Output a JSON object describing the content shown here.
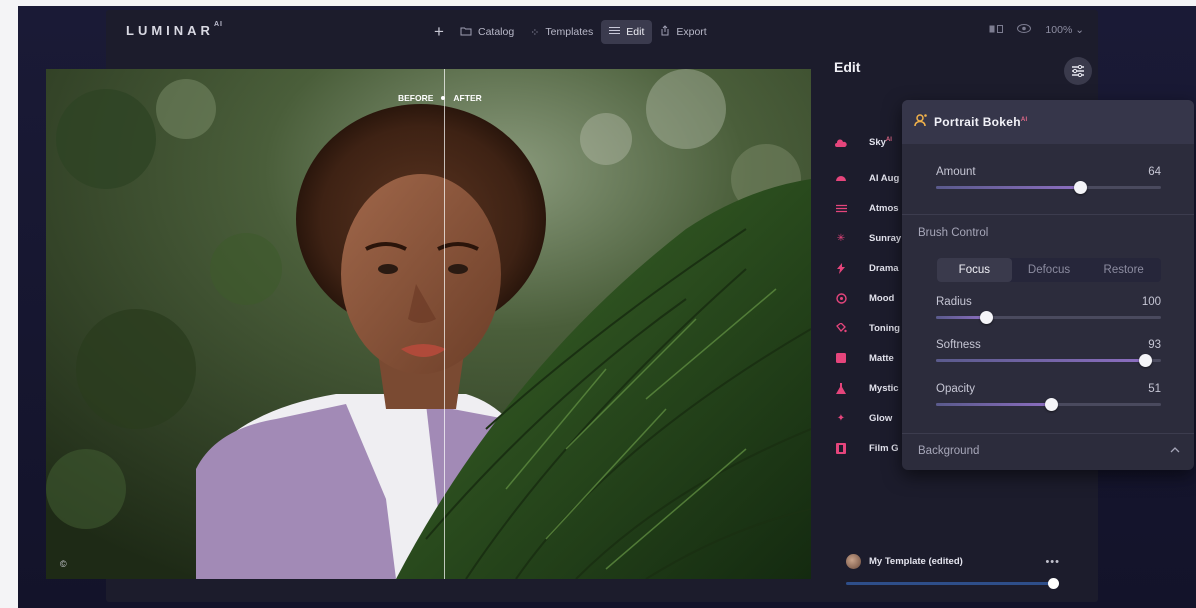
{
  "app": {
    "logo_text": "LUMINAR",
    "logo_sup": "AI"
  },
  "nav": {
    "items": [
      {
        "label": "Catalog",
        "icon": "folder-icon",
        "active": false
      },
      {
        "label": "Templates",
        "icon": "sparkle-icon",
        "active": false
      },
      {
        "label": "Edit",
        "icon": "sliders-icon",
        "active": true
      },
      {
        "label": "Export",
        "icon": "share-icon",
        "active": false
      }
    ],
    "zoom": "100%"
  },
  "photo": {
    "before_label": "BEFORE",
    "after_label": "AFTER"
  },
  "edit_panel": {
    "title": "Edit",
    "tools": [
      {
        "label": "Sky",
        "icon": "cloud-icon",
        "ai": true
      },
      {
        "label": "AI Aug",
        "icon": "dome-icon",
        "ai": false
      },
      {
        "label": "Atmos",
        "icon": "haze-icon",
        "ai": false
      },
      {
        "label": "Sunray",
        "icon": "sun-icon",
        "ai": false
      },
      {
        "label": "Drama",
        "icon": "lightning-icon",
        "ai": false
      },
      {
        "label": "Mood",
        "icon": "mood-icon",
        "ai": false
      },
      {
        "label": "Toning",
        "icon": "bucket-icon",
        "ai": false
      },
      {
        "label": "Matte",
        "icon": "square-icon",
        "ai": false
      },
      {
        "label": "Mystic",
        "icon": "flask-icon",
        "ai": false
      },
      {
        "label": "Glow",
        "icon": "spark-icon",
        "ai": false
      },
      {
        "label": "Film G",
        "icon": "film-icon",
        "ai": false
      }
    ],
    "template": {
      "name": "My Template (edited)",
      "more": "•••"
    }
  },
  "popup": {
    "title": "Portrait Bokeh",
    "title_sup": "AI",
    "amount": {
      "label": "Amount",
      "value": 64
    },
    "brush_control_label": "Brush Control",
    "brush_modes": [
      {
        "label": "Focus",
        "active": true
      },
      {
        "label": "Defocus",
        "active": false
      },
      {
        "label": "Restore",
        "active": false
      }
    ],
    "radius": {
      "label": "Radius",
      "value": 100,
      "fraction": 0.22
    },
    "softness": {
      "label": "Softness",
      "value": 93
    },
    "opacity": {
      "label": "Opacity",
      "value": 51
    },
    "background_label": "Background"
  },
  "colors": {
    "accent_pink": "#e5457c",
    "window_bg": "#1c1c2c",
    "popup_bg": "#2c2c3c"
  }
}
